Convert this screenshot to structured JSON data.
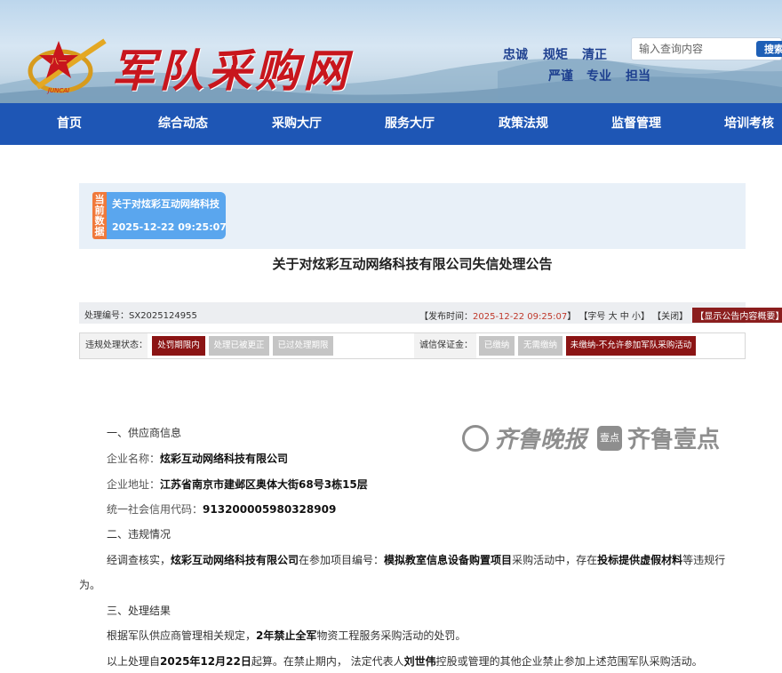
{
  "header": {
    "site_title": "军队采购网",
    "emblem_text": "JUNCAI",
    "emblem_star_text": "八一",
    "slogans_row1": [
      "忠诚",
      "规矩",
      "清正"
    ],
    "slogans_row2": [
      "严谨",
      "专业",
      "担当"
    ],
    "search_placeholder": "输入查询内容",
    "search_button": "搜索"
  },
  "nav": {
    "items": [
      "首页",
      "综合动态",
      "采购大厅",
      "服务大厅",
      "政策法规",
      "监督管理",
      "培训考核"
    ]
  },
  "current": {
    "tag": "当前数据",
    "title": "关于对炫彩互动网络科技",
    "time": "2025-12-22 09:25:07"
  },
  "notice": {
    "title": "关于对炫彩互动网络科技有限公司失信处理公告",
    "id_label": "处理编号：",
    "id_value": "SX2025124955",
    "publish_prefix": "【发布时间：",
    "publish_time": "2025-12-22 09:25:07",
    "publish_suffix": "】",
    "font_size_text": "【字号 大 中 小】",
    "close_text": "【关闭】",
    "summary_button": "【显示公告内容概要】"
  },
  "status": {
    "violation_label": "违规处理状态：",
    "violation_chips": [
      {
        "label": "处罚期限内",
        "active": true
      },
      {
        "label": "处理已被更正",
        "active": false
      },
      {
        "label": "已过处理期限",
        "active": false
      }
    ],
    "deposit_label": "诚信保证金：",
    "deposit_chips": [
      {
        "label": "已缴纳",
        "active": false
      },
      {
        "label": "无需缴纳",
        "active": false
      },
      {
        "label": "未缴纳-不允许参加军队采购活动",
        "active": true
      }
    ]
  },
  "watermark": {
    "brand1": "齐鲁晚报",
    "box": "壹点",
    "brand2": "齐鲁壹点"
  },
  "body": {
    "s1_heading": "一、供应商信息",
    "company_label": "企业名称：",
    "company_value": "炫彩互动网络科技有限公司",
    "address_label": "企业地址：",
    "address_value": "江苏省南京市建邺区奥体大街68号3栋15层",
    "credit_label": "统一社会信用代码：",
    "credit_value": "913200005980328909",
    "s2_heading": "二、违规情况",
    "v_p1": "经调查核实，",
    "v_company": "炫彩互动网络科技有限公司",
    "v_p2": "在参加项目编号：",
    "v_project": "模拟教室信息设备购置项目",
    "v_p3": "采购活动中，存在",
    "v_violation": "投标提供虚假材料",
    "v_p4": "等违规行",
    "v_tail": "为。",
    "s3_heading": "三、处理结果",
    "r1_p1": "根据军队供应商管理相关规定，",
    "r1_bold": "2年禁止全军",
    "r1_p2": "物资工程服务采购活动的处罚。",
    "r2_p1": "以上处理自",
    "r2_date": "2025年12月22日",
    "r2_p2": "起算。在禁止期内，  法定代表人",
    "r2_person": "刘世伟",
    "r2_p3": "控股或管理的其他企业禁止参加上述范围军队采购活动。"
  }
}
